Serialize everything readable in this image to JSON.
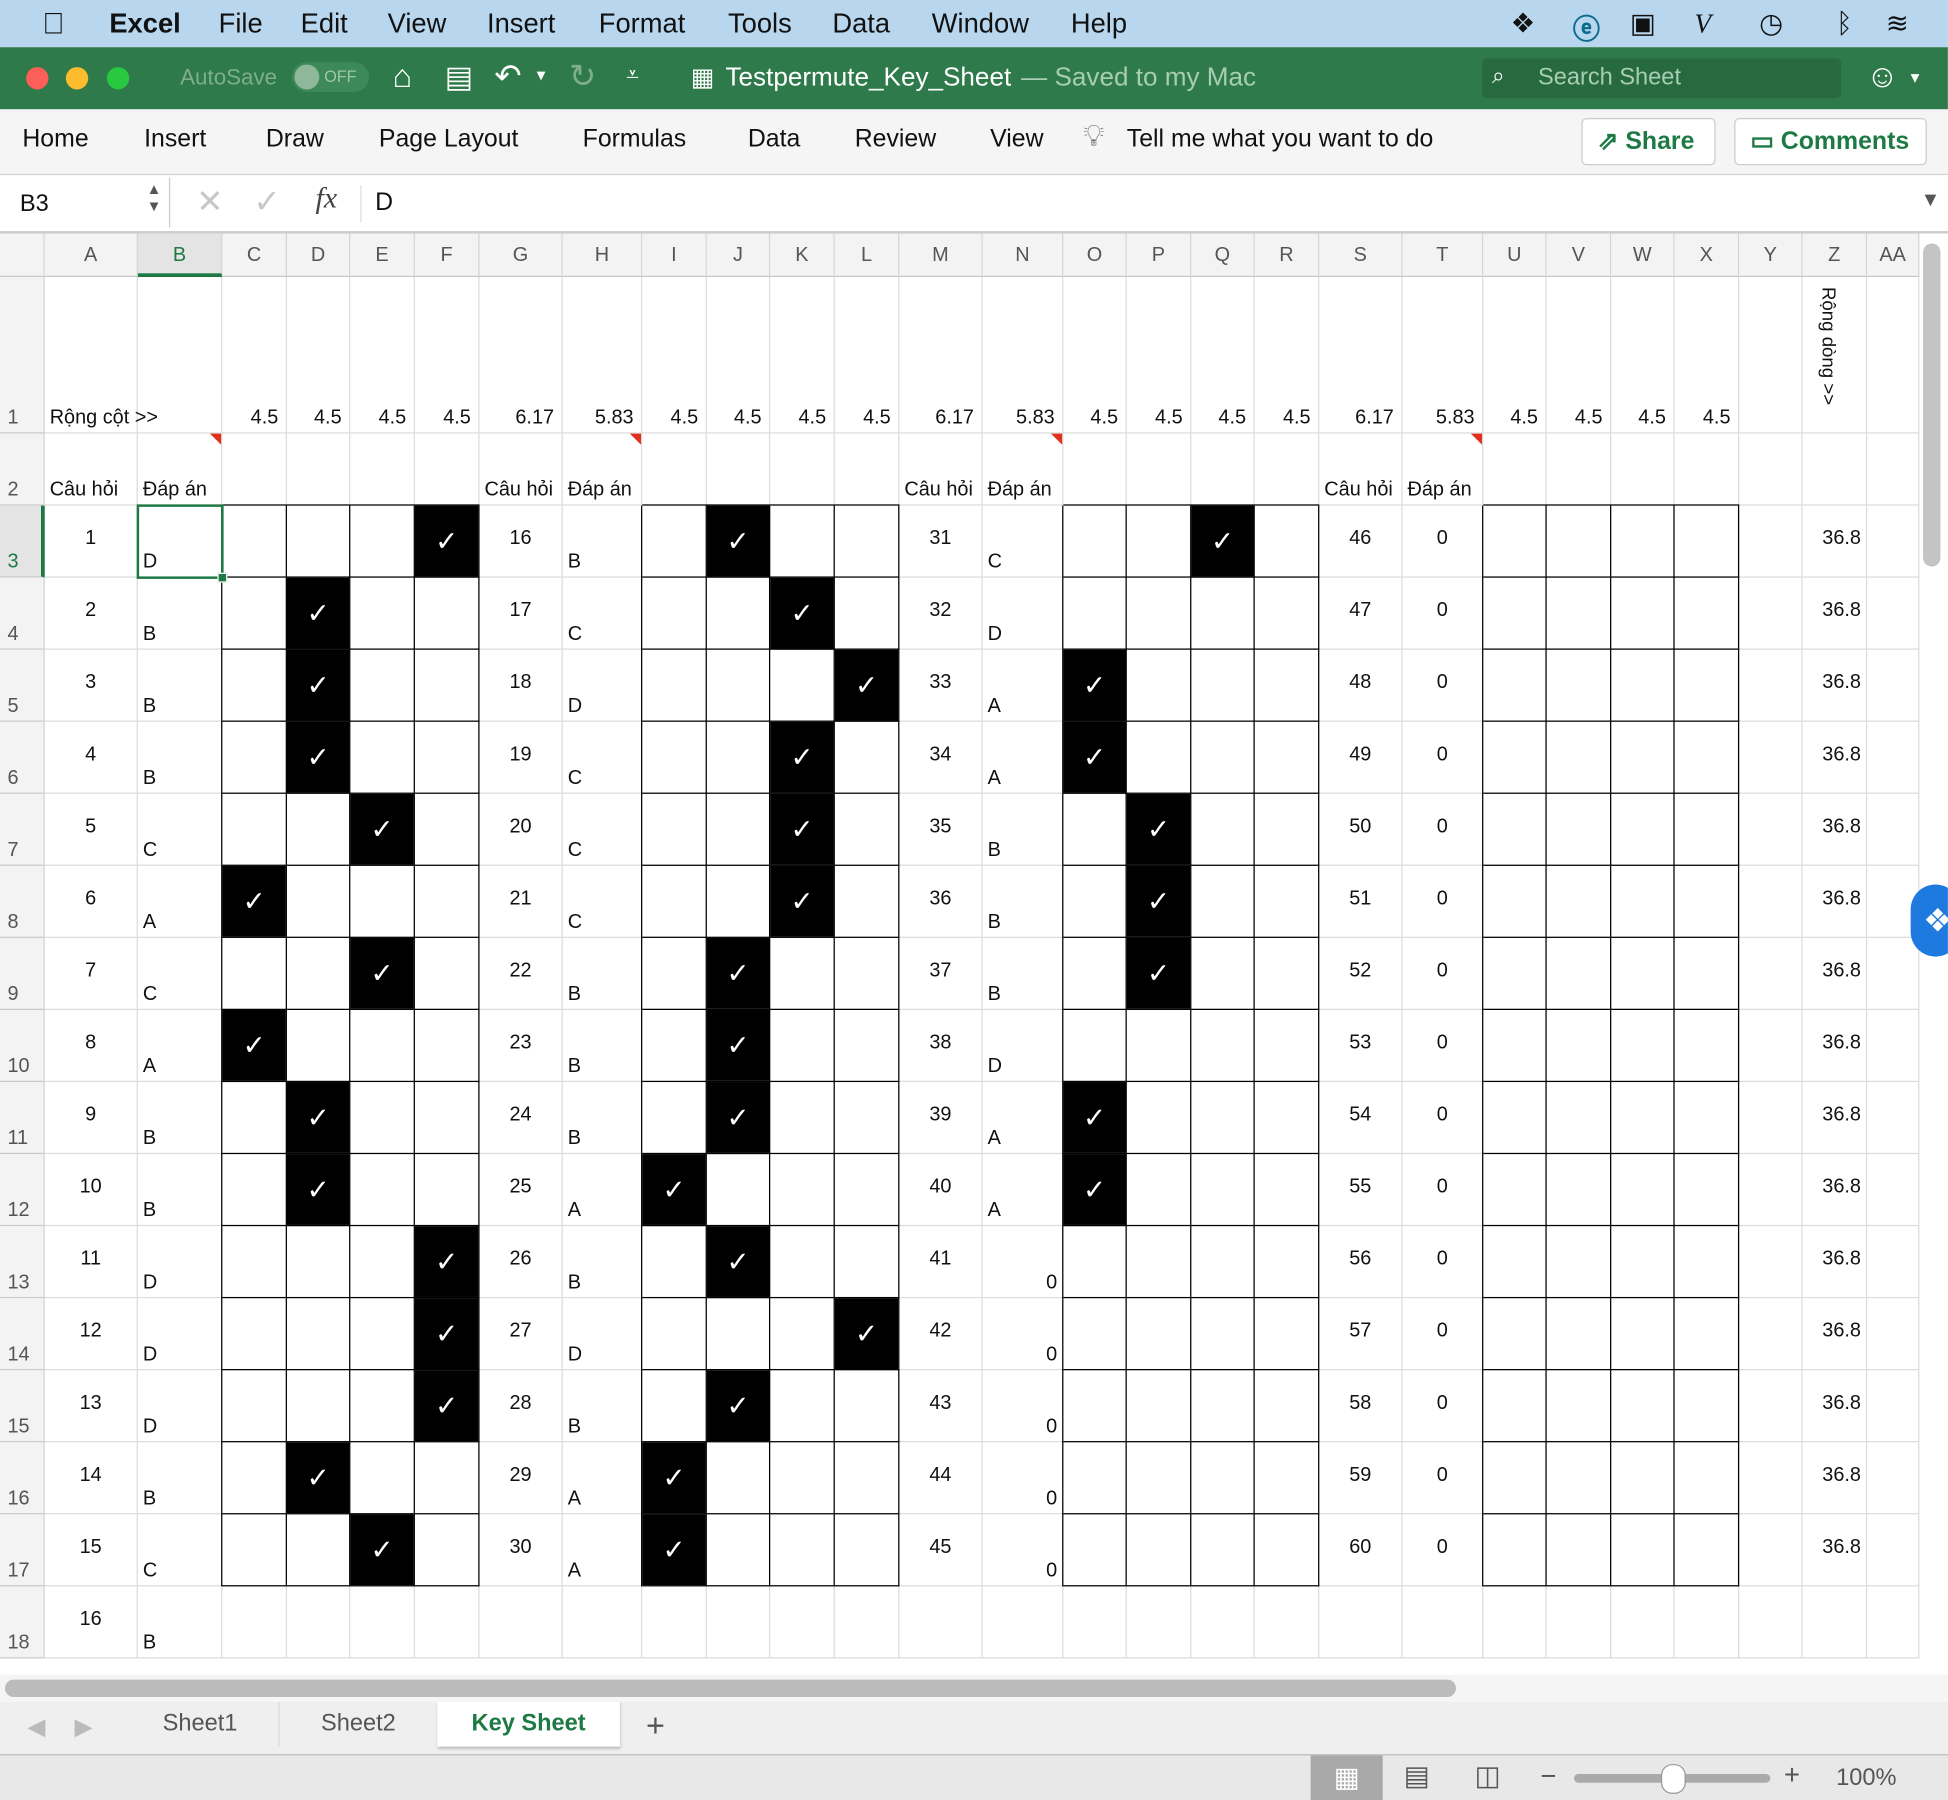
{
  "menubar": {
    "app": "Excel",
    "items": [
      "File",
      "Edit",
      "View",
      "Insert",
      "Format",
      "Tools",
      "Data",
      "Window",
      "Help"
    ]
  },
  "titlebar": {
    "autosave": "AutoSave",
    "toggle": "OFF",
    "filename": "Testpermute_Key_Sheet",
    "saved": "— Saved to my Mac",
    "search_placeholder": "Search Sheet"
  },
  "ribbon": {
    "tabs": [
      "Home",
      "Insert",
      "Draw",
      "Page Layout",
      "Formulas",
      "Data",
      "Review",
      "View"
    ],
    "tell_me": "Tell me what you want to do",
    "share": "Share",
    "comments": "Comments"
  },
  "formula_bar": {
    "name_box": "B3",
    "fx": "fx",
    "value": "D"
  },
  "sheet": {
    "columns": [
      "A",
      "B",
      "C",
      "D",
      "E",
      "F",
      "G",
      "H",
      "I",
      "J",
      "K",
      "L",
      "M",
      "N",
      "O",
      "P",
      "Q",
      "R",
      "S",
      "T",
      "U",
      "V",
      "W",
      "X",
      "Y",
      "Z",
      "AA"
    ],
    "rows": [
      "1",
      "2",
      "3",
      "4",
      "5",
      "6",
      "7",
      "8",
      "9",
      "10",
      "11",
      "12",
      "13",
      "14",
      "15",
      "16",
      "17",
      "18"
    ],
    "selected_cell": "B3",
    "check_glyph": "✓",
    "cells": {
      "A1": "Rộng cột >>",
      "C1": "4.5",
      "D1": "4.5",
      "E1": "4.5",
      "F1": "4.5",
      "G1": "6.17",
      "H1": "5.83",
      "I1": "4.5",
      "J1": "4.5",
      "K1": "4.5",
      "L1": "4.5",
      "M1": "6.17",
      "N1": "5.83",
      "O1": "4.5",
      "P1": "4.5",
      "Q1": "4.5",
      "R1": "4.5",
      "S1": "6.17",
      "T1": "5.83",
      "U1": "4.5",
      "V1": "4.5",
      "W1": "4.5",
      "X1": "4.5",
      "Z1": "Rộng dòng >>",
      "A2": "Câu hỏi",
      "B2": "Đáp án",
      "G2": "Câu hỏi",
      "H2": "Đáp án",
      "M2": "Câu hỏi",
      "N2": "Đáp án",
      "S2": "Câu hỏi",
      "T2": "Đáp án",
      "A3": "1",
      "B3": "D",
      "G3": "16",
      "H3": "B",
      "M3": "31",
      "N3": "C",
      "S3": "46",
      "T3": "0",
      "Z3": "36.8",
      "A4": "2",
      "B4": "B",
      "G4": "17",
      "H4": "C",
      "M4": "32",
      "N4": "D",
      "S4": "47",
      "T4": "0",
      "Z4": "36.8",
      "A5": "3",
      "B5": "B",
      "G5": "18",
      "H5": "D",
      "M5": "33",
      "N5": "A",
      "S5": "48",
      "T5": "0",
      "Z5": "36.8",
      "A6": "4",
      "B6": "B",
      "G6": "19",
      "H6": "C",
      "M6": "34",
      "N6": "A",
      "S6": "49",
      "T6": "0",
      "Z6": "36.8",
      "A7": "5",
      "B7": "C",
      "G7": "20",
      "H7": "C",
      "M7": "35",
      "N7": "B",
      "S7": "50",
      "T7": "0",
      "Z7": "36.8",
      "A8": "6",
      "B8": "A",
      "G8": "21",
      "H8": "C",
      "M8": "36",
      "N8": "B",
      "S8": "51",
      "T8": "0",
      "Z8": "36.8",
      "A9": "7",
      "B9": "C",
      "G9": "22",
      "H9": "B",
      "M9": "37",
      "N9": "B",
      "S9": "52",
      "T9": "0",
      "Z9": "36.8",
      "A10": "8",
      "B10": "A",
      "G10": "23",
      "H10": "B",
      "M10": "38",
      "N10": "D",
      "S10": "53",
      "T10": "0",
      "Z10": "36.8",
      "A11": "9",
      "B11": "B",
      "G11": "24",
      "H11": "B",
      "M11": "39",
      "N11": "A",
      "S11": "54",
      "T11": "0",
      "Z11": "36.8",
      "A12": "10",
      "B12": "B",
      "G12": "25",
      "H12": "A",
      "M12": "40",
      "N12": "A",
      "S12": "55",
      "T12": "0",
      "Z12": "36.8",
      "A13": "11",
      "B13": "D",
      "G13": "26",
      "H13": "B",
      "M13": "41",
      "N13": "0",
      "S13": "56",
      "T13": "0",
      "Z13": "36.8",
      "A14": "12",
      "B14": "D",
      "G14": "27",
      "H14": "D",
      "M14": "42",
      "N14": "0",
      "S14": "57",
      "T14": "0",
      "Z14": "36.8",
      "A15": "13",
      "B15": "D",
      "G15": "28",
      "H15": "B",
      "M15": "43",
      "N15": "0",
      "S15": "58",
      "T15": "0",
      "Z15": "36.8",
      "A16": "14",
      "B16": "B",
      "G16": "29",
      "H16": "A",
      "M16": "44",
      "N16": "0",
      "S16": "59",
      "T16": "0",
      "Z16": "36.8",
      "A17": "15",
      "B17": "C",
      "G17": "30",
      "H17": "A",
      "M17": "45",
      "N17": "0",
      "S17": "60",
      "T17": "0",
      "Z17": "36.8",
      "A18": "16",
      "B18": "B"
    },
    "checked_cells": [
      "F3",
      "D4",
      "D5",
      "D6",
      "E7",
      "C8",
      "E9",
      "C10",
      "D11",
      "D12",
      "F13",
      "F14",
      "F15",
      "D16",
      "E17",
      "J3",
      "K4",
      "L5",
      "K6",
      "K7",
      "K8",
      "J9",
      "J10",
      "J11",
      "I12",
      "J13",
      "L14",
      "J15",
      "I16",
      "I17",
      "Q3",
      "O5",
      "O6",
      "P7",
      "P8",
      "P9",
      "O11",
      "O12"
    ],
    "comment_cells": [
      "B2",
      "H2",
      "N2",
      "T2"
    ]
  },
  "sheet_tabs": [
    "Sheet1",
    "Sheet2",
    "Key Sheet"
  ],
  "active_tab": "Key Sheet",
  "status": {
    "zoom": "100%",
    "zoom_level": 100
  },
  "colors": {
    "accent": "#1e7a44",
    "titlebar": "#2f7a4a",
    "menubar": "#b8d7ee"
  }
}
